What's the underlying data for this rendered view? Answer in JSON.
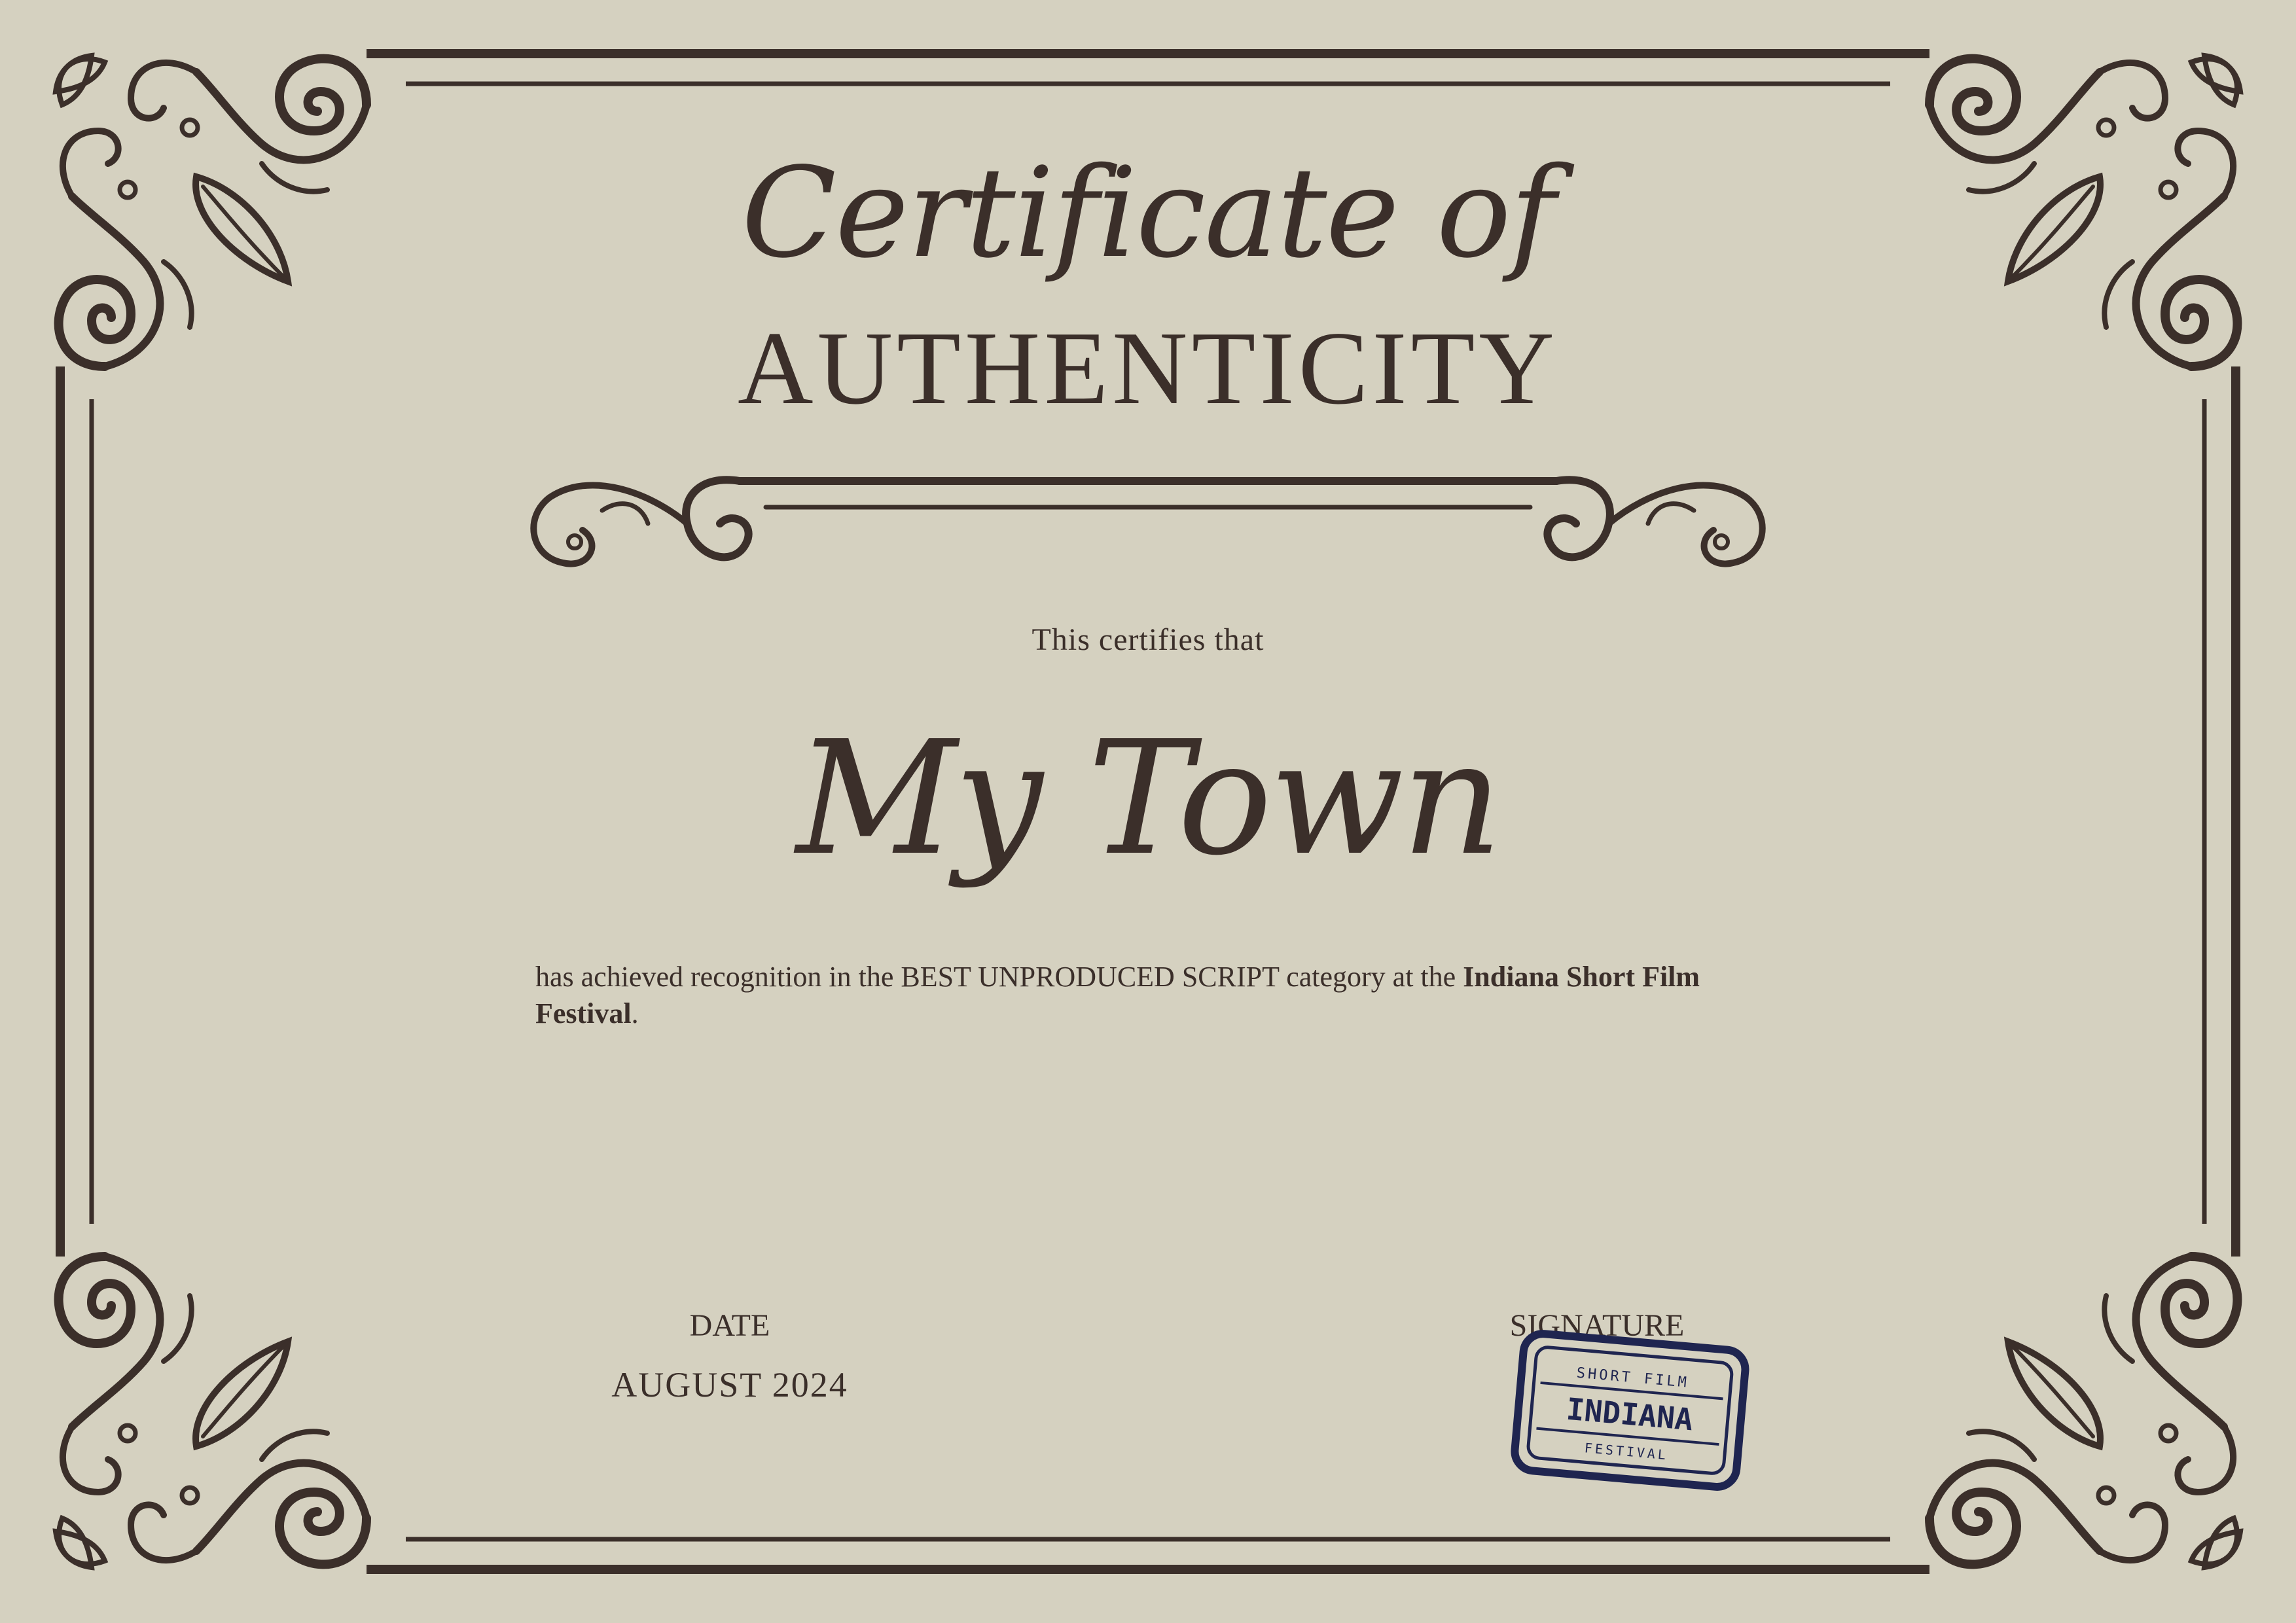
{
  "certificate": {
    "title_script": "Certificate of",
    "title_main": "AUTHENTICITY",
    "certifies_line": "This certifies that",
    "recipient": "My Town",
    "body_part1": "has achieved recognition in the BEST UNPRODUCED SCRIPT category at the ",
    "body_bold": "Indiana Short Film Festival",
    "body_end": "."
  },
  "footer": {
    "date_label": "DATE",
    "date_value": "AUGUST 2024",
    "signature_label": "SIGNATURE"
  },
  "stamp": {
    "top_text": "SHORT FILM",
    "main_text": "INDIANA",
    "bottom_text": "FESTIVAL",
    "color": "#1f2550"
  },
  "colors": {
    "background": "#d5d1c0",
    "ink": "#3b2f2a"
  }
}
